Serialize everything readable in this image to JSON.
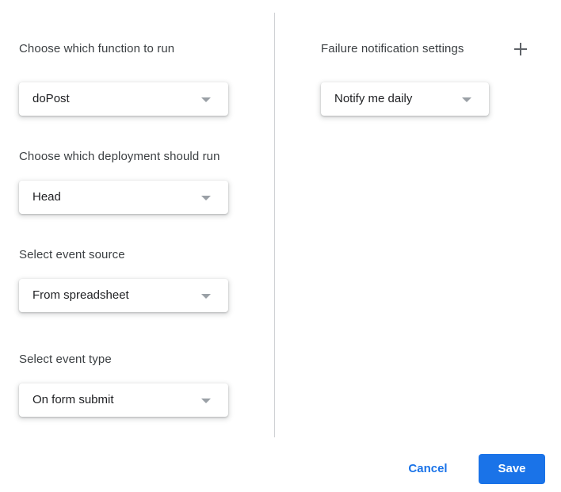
{
  "left": {
    "fields": [
      {
        "label": "Choose which function to run",
        "value": "doPost"
      },
      {
        "label": "Choose which deployment should run",
        "value": "Head"
      },
      {
        "label": "Select event source",
        "value": "From spreadsheet"
      },
      {
        "label": "Select event type",
        "value": "On form submit"
      }
    ]
  },
  "right": {
    "failure_label": "Failure notification settings",
    "failure_value": "Notify me daily",
    "add_icon": "plus-icon"
  },
  "footer": {
    "cancel_label": "Cancel",
    "save_label": "Save"
  },
  "colors": {
    "accent": "#1a73e8",
    "text": "#3c4043"
  }
}
